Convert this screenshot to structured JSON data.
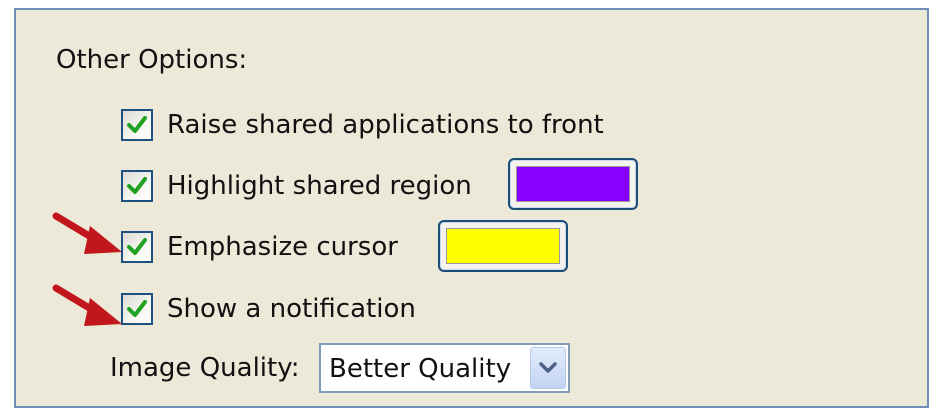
{
  "other_options": {
    "title": "Other Options:",
    "options": [
      {
        "label": "Raise shared applications to front",
        "checked": true
      },
      {
        "label": "Highlight shared region",
        "checked": true,
        "swatch_color": "#8800ff",
        "swatch_icon": "color-swatch"
      },
      {
        "label": "Emphasize cursor",
        "checked": true,
        "swatch_color": "#ffff00",
        "swatch_icon": "color-swatch"
      },
      {
        "label": "Show a notification",
        "checked": true
      }
    ],
    "image_quality": {
      "label": "Image Quality:",
      "value": "Better Quality",
      "icon": "chevron-down-icon"
    }
  },
  "annotations": {
    "arrow_color": "#c0161c",
    "arrow_icon": "red-pointer-arrow"
  },
  "colors": {
    "panel_background": "#ece9d8",
    "panel_border": "#6e8fb8",
    "check_color": "#21a121"
  }
}
